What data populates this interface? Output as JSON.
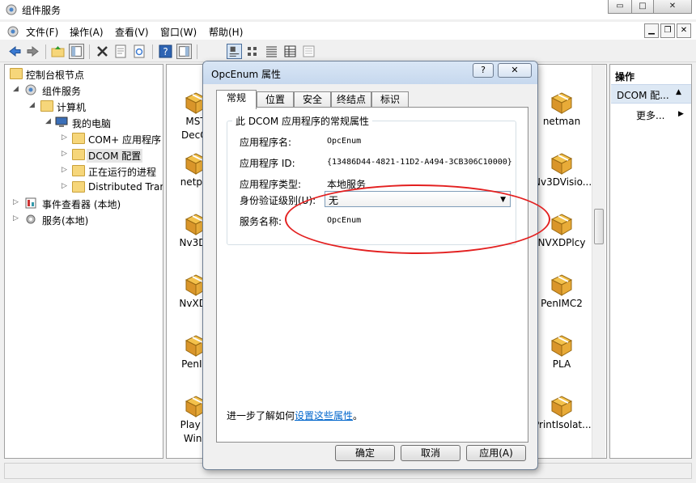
{
  "window": {
    "title": "组件服务",
    "controls": {
      "minimize": "▭",
      "maximize": "□",
      "close": "✕"
    }
  },
  "menu": {
    "items": [
      "文件(F)",
      "操作(A)",
      "查看(V)",
      "窗口(W)",
      "帮助(H)"
    ]
  },
  "tree": {
    "nodes": [
      {
        "label": "控制台根节点",
        "icon": "folder-icon"
      },
      {
        "label": "组件服务",
        "icon": "component-services-icon"
      },
      {
        "label": "计算机",
        "icon": "folder-icon"
      },
      {
        "label": "我的电脑",
        "icon": "computer-icon"
      },
      {
        "label": "COM+ 应用程序",
        "icon": "folder-icon"
      },
      {
        "label": "DCOM 配置",
        "icon": "folder-icon"
      },
      {
        "label": "正在运行的进程",
        "icon": "folder-icon"
      },
      {
        "label": "Distributed Tran",
        "icon": "folder-icon"
      },
      {
        "label": "事件查看器 (本地)",
        "icon": "event-viewer-icon"
      },
      {
        "label": "服务(本地)",
        "icon": "services-icon"
      }
    ]
  },
  "list": {
    "left_column": [
      "MST\nDecOl",
      "netprc",
      "Nv3DV",
      "NvXDS",
      "PenIM",
      "Play w\nWind"
    ],
    "right_column": [
      "netman",
      "Nv3DVisio...",
      "NVXDPlcy",
      "PenIMC2",
      "PLA",
      "PrintIsolat..."
    ]
  },
  "actions": {
    "header": "操作",
    "section": "DCOM 配...",
    "more": "更多..."
  },
  "dialog": {
    "title": "OpcEnum 属性",
    "help_button": "?",
    "close_button": "✕",
    "tabs": [
      "常规",
      "位置",
      "安全",
      "终结点",
      "标识"
    ],
    "group_title": "此 DCOM 应用程序的常规属性",
    "fields": {
      "app_name_label": "应用程序名:",
      "app_name_value": "OpcEnum",
      "app_id_label": "应用程序 ID:",
      "app_id_value": "{13486D44-4821-11D2-A494-3CB306C10000}",
      "app_type_label": "应用程序类型:",
      "app_type_value": "本地服务",
      "auth_level_label": "身份验证级别(U):",
      "auth_level_value": "无",
      "service_name_label": "服务名称:",
      "service_name_value": "OpcEnum"
    },
    "learn_more_prefix": "进一步了解如何",
    "learn_more_link": "设置这些属性",
    "learn_more_suffix": "。",
    "buttons": {
      "ok": "确定",
      "cancel": "取消",
      "apply": "应用(A)"
    }
  },
  "annotation_color": "#e32020"
}
